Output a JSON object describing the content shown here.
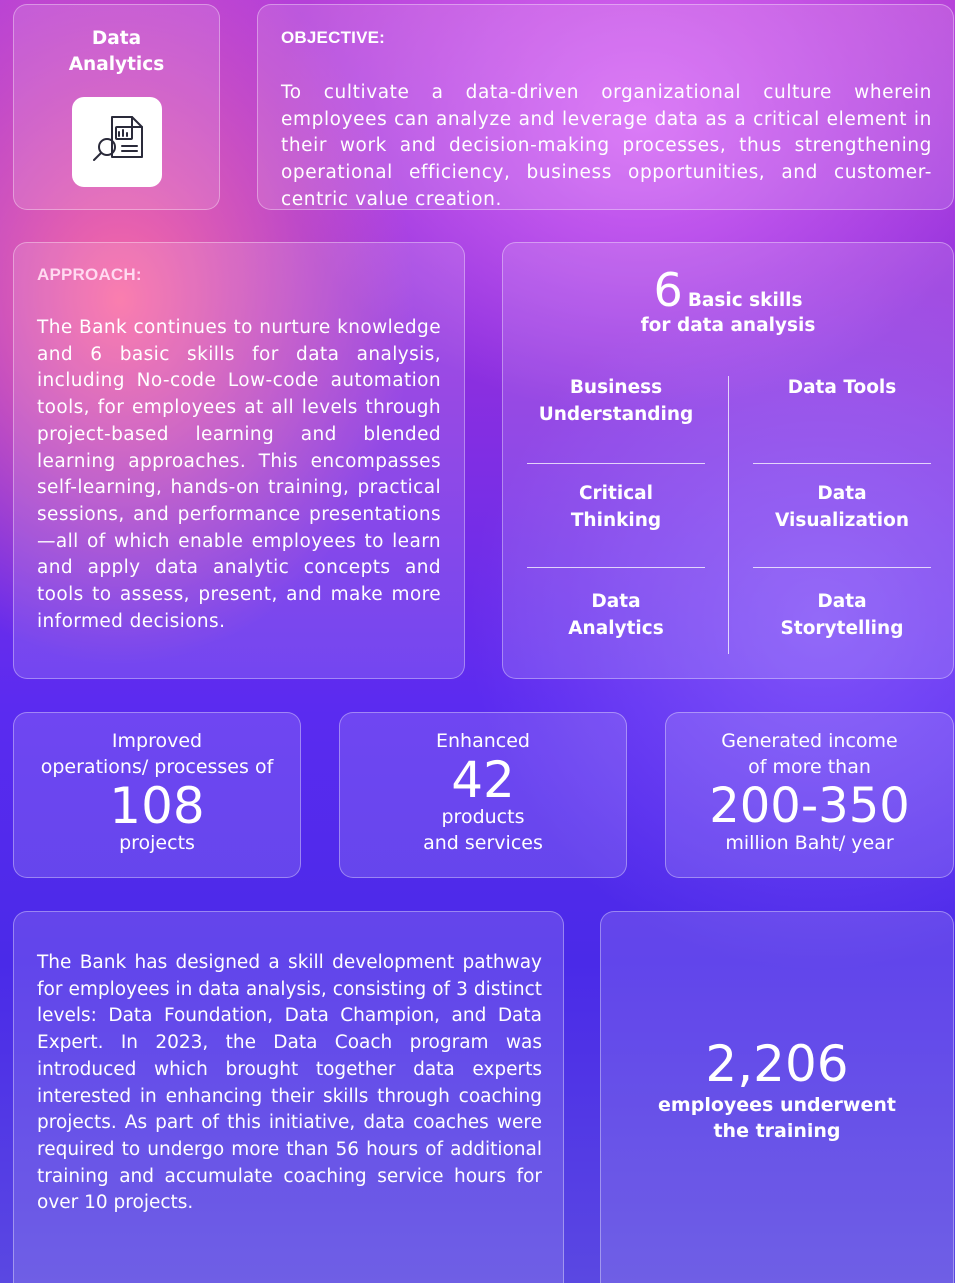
{
  "header": {
    "title_line1": "Data",
    "title_line2": "Analytics",
    "icon": "report-search-icon"
  },
  "objective": {
    "heading": "OBJECTIVE:",
    "text": "To cultivate a data-driven organizational culture wherein employees can analyze and leverage data as a critical element in their work and decision-making processes, thus strengthening operational efficiency, business opportunities, and customer-centric value creation."
  },
  "approach": {
    "heading": "APPROACH:",
    "text": "The Bank continues to nurture knowledge and 6 basic skills for data analysis, including No-code Low-code automation tools, for employees at all levels through project-based learning and blended learning approaches. This encompasses self-learning, hands-on training, practical sessions, and performance presentations—all of which enable employees to learn and apply data analytic concepts and tools to assess, present, and make more informed decisions."
  },
  "skills": {
    "number": "6",
    "title": "Basic skills",
    "subtitle": "for data analysis",
    "items": [
      {
        "line1": "Business",
        "line2": "Understanding"
      },
      {
        "line1": "Data Tools",
        "line2": ""
      },
      {
        "line1": "Critical",
        "line2": "Thinking"
      },
      {
        "line1": "Data",
        "line2": "Visualization"
      },
      {
        "line1": "Data",
        "line2": "Analytics"
      },
      {
        "line1": "Data",
        "line2": "Storytelling"
      }
    ]
  },
  "stats": [
    {
      "pre1": "Improved",
      "pre2": "operations/ processes of",
      "number": "108",
      "post1": "projects",
      "post2": ""
    },
    {
      "pre1": "Enhanced",
      "pre2": "",
      "number": "42",
      "post1": "products",
      "post2": "and services"
    },
    {
      "pre1": "Generated income",
      "pre2": "of more than",
      "number": "200-350",
      "post1": "million Baht/ year",
      "post2": ""
    }
  ],
  "pathway": {
    "text": "The Bank has designed a skill development pathway for employees in data analysis, consisting of 3 distinct levels: Data Foundation, Data Champion, and Data Expert. In 2023, the Data Coach program was introduced which brought together data experts interested in enhancing their skills through coaching projects. As part of this initiative, data coaches were required to undergo more than 56 hours of additional training and accumulate coaching service hours for over 10 projects."
  },
  "training": {
    "number": "2,206",
    "line1": "employees underwent",
    "line2": "the training"
  },
  "colors": {
    "icon_stroke": "#2a2a3a",
    "heading_pink": "#ffd9f0"
  }
}
